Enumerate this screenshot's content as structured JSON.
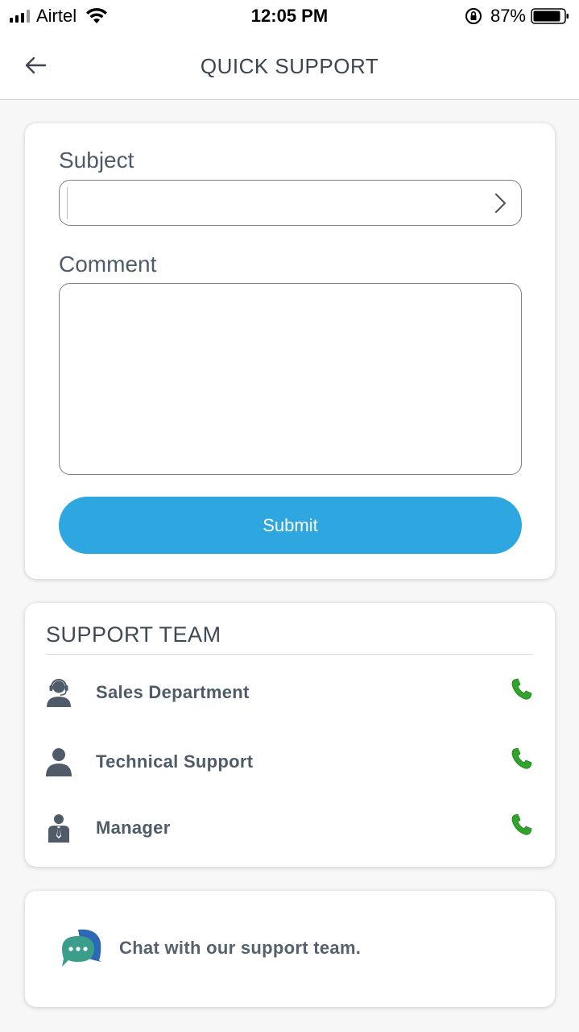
{
  "status_bar": {
    "carrier": "Airtel",
    "time": "12:05 PM",
    "battery_percent": "87%"
  },
  "header": {
    "title": "QUICK SUPPORT"
  },
  "form": {
    "subject_label": "Subject",
    "subject_value": "",
    "comment_label": "Comment",
    "comment_value": "",
    "submit_label": "Submit"
  },
  "support_team": {
    "title": "SUPPORT TEAM",
    "members": [
      {
        "label": "Sales Department",
        "icon": "headset-agent-icon"
      },
      {
        "label": "Technical Support",
        "icon": "person-icon"
      },
      {
        "label": "Manager",
        "icon": "person-tie-icon"
      }
    ],
    "call_icon": "phone-icon",
    "call_icon_color": "#2fa52a"
  },
  "chat": {
    "label": "Chat with our support team.",
    "icon": "chat-bubbles-icon"
  },
  "colors": {
    "accent": "#2ea6e0",
    "text": "#4f5b68",
    "call_green": "#2fa52a"
  }
}
